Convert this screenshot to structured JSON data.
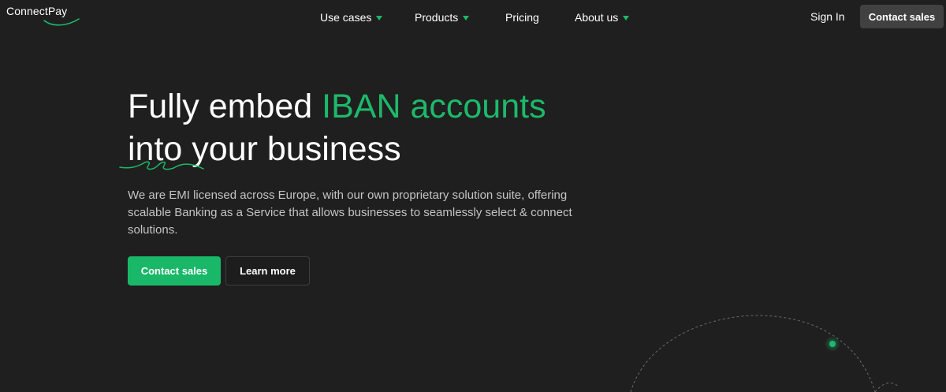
{
  "brand": {
    "name": "ConnectPay",
    "accent_color": "#1db96a"
  },
  "nav": {
    "items": [
      {
        "label": "Use cases",
        "has_dropdown": true
      },
      {
        "label": "Products",
        "has_dropdown": true
      },
      {
        "label": "Pricing",
        "has_dropdown": false
      },
      {
        "label": "About us",
        "has_dropdown": true
      }
    ],
    "sign_in": "Sign In",
    "cta": "Contact sales"
  },
  "hero": {
    "title_part1": "Fully embed ",
    "title_accent": "IBAN accounts",
    "title_line2": "into your business",
    "subtitle": "We are EMI licensed across Europe, with our own proprietary solution suite, offering scalable Banking as a Service that allows businesses to seamlessly select & connect solutions.",
    "primary_button": "Contact sales",
    "secondary_button": "Learn more"
  },
  "icons": {
    "dropdown": "caret-down-icon",
    "logo_mark": "swoosh-icon",
    "orbit": "orbit-decoration"
  }
}
